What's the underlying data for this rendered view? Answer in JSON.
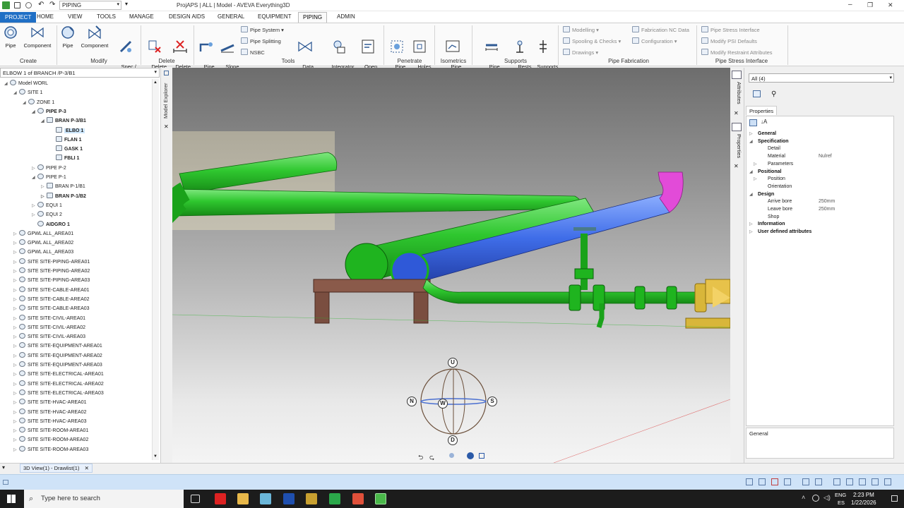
{
  "window": {
    "title": "ProjAPS | ALL | Model - AVEVA Everything3D",
    "quick_module": "PIPING",
    "controls": [
      "–",
      "❐",
      "✕"
    ]
  },
  "menu_tabs": [
    {
      "label": "PROJECT",
      "active": false,
      "project": true
    },
    {
      "label": "HOME"
    },
    {
      "label": "VIEW"
    },
    {
      "label": "TOOLS"
    },
    {
      "label": "MANAGE"
    },
    {
      "label": "DESIGN AIDS"
    },
    {
      "label": "GENERAL"
    },
    {
      "label": "EQUIPMENT"
    },
    {
      "label": "PIPING",
      "active": true
    },
    {
      "label": "ADMIN"
    }
  ],
  "ribbon": {
    "create": {
      "group": "Create",
      "buttons": [
        "Pipe",
        "Component"
      ]
    },
    "modify": {
      "group": "Modify",
      "buttons": [
        "Pipe",
        "Component",
        "Spec /\nBore ▾"
      ]
    },
    "delete": {
      "group": "Delete",
      "buttons": [
        "Delete\n▾",
        "Delete\nRange"
      ]
    },
    "tools": {
      "group": "Tools",
      "buttons": [
        "Pipe\nRouter",
        "Slope\nPipe",
        "Data\nConsistency",
        "Integrator\nMode",
        "Open\nDiagram"
      ],
      "small": [
        "Pipe System ▾",
        "Pipe Splitting",
        "NSBC"
      ]
    },
    "penetrate": {
      "group": "Penetrate",
      "buttons": [
        "Pipe\n▾",
        "Holes\n▾"
      ]
    },
    "isometrics": {
      "group": "Isometrics",
      "buttons": [
        "Pipe\n▾"
      ]
    },
    "supports": {
      "group": "Supports",
      "buttons": [
        "Pipe\nDimensions",
        "Rests",
        "Supports\nBrowser"
      ]
    },
    "fabrication": {
      "group": "Pipe Fabrication",
      "small": [
        "Modelling ▾",
        "Spooling & Checks ▾",
        "Drawings ▾",
        "Fabrication NC Data",
        "Configuration ▾"
      ]
    },
    "stress": {
      "group": "Pipe Stress Interface",
      "small": [
        "Pipe Stress Interface",
        "Modify PSI Defaults",
        "Modify Restraint Attributes"
      ]
    }
  },
  "explorer": {
    "current_element": "ELBOW 1 of BRANCH /P-3/B1",
    "vtab_label": "Model Explorer",
    "tree": [
      {
        "label": "Model WORL",
        "depth": 0,
        "exp": "◢",
        "bold": false
      },
      {
        "label": "SITE 1",
        "depth": 1,
        "exp": "◢"
      },
      {
        "label": "ZONE 1",
        "depth": 2,
        "exp": "◢"
      },
      {
        "label": "PIPE P-3",
        "depth": 3,
        "exp": "◢",
        "bold": true
      },
      {
        "label": "BRAN P-3/B1",
        "depth": 4,
        "exp": "◢",
        "bold": true
      },
      {
        "label": "ELBO 1",
        "depth": 5,
        "exp": "",
        "bold": true,
        "sel": true
      },
      {
        "label": "FLAN 1",
        "depth": 5,
        "exp": "",
        "bold": true
      },
      {
        "label": "GASK 1",
        "depth": 5,
        "exp": "",
        "bold": true
      },
      {
        "label": "FBLI 1",
        "depth": 5,
        "exp": "",
        "bold": true
      },
      {
        "label": "PIPE P-2",
        "depth": 3,
        "exp": "▷"
      },
      {
        "label": "PIPE P-1",
        "depth": 3,
        "exp": "◢"
      },
      {
        "label": "BRAN P-1/B1",
        "depth": 4,
        "exp": "▷"
      },
      {
        "label": "BRAN P-1/B2",
        "depth": 4,
        "exp": "▷",
        "bold": true
      },
      {
        "label": "EQUI 1",
        "depth": 3,
        "exp": "▷"
      },
      {
        "label": "EQUI 2",
        "depth": 3,
        "exp": "▷"
      },
      {
        "label": "AIDGRO 1",
        "depth": 3,
        "exp": "",
        "bold": true
      },
      {
        "label": "GPWL ALL_AREA01",
        "depth": 1,
        "exp": "▷"
      },
      {
        "label": "GPWL ALL_AREA02",
        "depth": 1,
        "exp": "▷"
      },
      {
        "label": "GPWL ALL_AREA03",
        "depth": 1,
        "exp": "▷"
      },
      {
        "label": "SITE SITE-PIPING-AREA01",
        "depth": 1,
        "exp": "▷"
      },
      {
        "label": "SITE SITE-PIPING-AREA02",
        "depth": 1,
        "exp": "▷"
      },
      {
        "label": "SITE SITE-PIPING-AREA03",
        "depth": 1,
        "exp": "▷"
      },
      {
        "label": "SITE SITE-CABLE-AREA01",
        "depth": 1,
        "exp": "▷"
      },
      {
        "label": "SITE SITE-CABLE-AREA02",
        "depth": 1,
        "exp": "▷"
      },
      {
        "label": "SITE SITE-CABLE-AREA03",
        "depth": 1,
        "exp": "▷"
      },
      {
        "label": "SITE SITE-CIVIL-AREA01",
        "depth": 1,
        "exp": "▷"
      },
      {
        "label": "SITE SITE-CIVIL-AREA02",
        "depth": 1,
        "exp": "▷"
      },
      {
        "label": "SITE SITE-CIVIL-AREA03",
        "depth": 1,
        "exp": "▷"
      },
      {
        "label": "SITE SITE-EQUIPMENT-AREA01",
        "depth": 1,
        "exp": "▷"
      },
      {
        "label": "SITE SITE-EQUIPMENT-AREA02",
        "depth": 1,
        "exp": "▷"
      },
      {
        "label": "SITE SITE-EQUIPMENT-AREA03",
        "depth": 1,
        "exp": "▷"
      },
      {
        "label": "SITE SITE-ELECTRICAL-AREA01",
        "depth": 1,
        "exp": "▷"
      },
      {
        "label": "SITE SITE-ELECTRICAL-AREA02",
        "depth": 1,
        "exp": "▷"
      },
      {
        "label": "SITE SITE-ELECTRICAL-AREA03",
        "depth": 1,
        "exp": "▷"
      },
      {
        "label": "SITE SITE-HVAC-AREA01",
        "depth": 1,
        "exp": "▷"
      },
      {
        "label": "SITE SITE-HVAC-AREA02",
        "depth": 1,
        "exp": "▷"
      },
      {
        "label": "SITE SITE-HVAC-AREA03",
        "depth": 1,
        "exp": "▷"
      },
      {
        "label": "SITE SITE-ROOM-AREA01",
        "depth": 1,
        "exp": "▷"
      },
      {
        "label": "SITE SITE-ROOM-AREA02",
        "depth": 1,
        "exp": "▷"
      },
      {
        "label": "SITE SITE-ROOM-AREA03",
        "depth": 1,
        "exp": "▷"
      }
    ]
  },
  "compass": {
    "up": "U",
    "down": "D",
    "north": "N",
    "south": "S",
    "west": "W"
  },
  "properties": {
    "vtabs": [
      "Attributes",
      "Properties"
    ],
    "filter": "All (4)",
    "tab": "Properties",
    "rows": [
      {
        "k": "General",
        "cat": true,
        "tg": "▷"
      },
      {
        "k": "Specification",
        "cat": true,
        "tg": "◢"
      },
      {
        "k": "Detail",
        "v": ""
      },
      {
        "k": "Material",
        "v": "Nulref"
      },
      {
        "k": "Parameters",
        "v": "",
        "tg": "▷"
      },
      {
        "k": "Positional",
        "cat": true,
        "tg": "◢"
      },
      {
        "k": "Position",
        "v": "",
        "tg": "▷"
      },
      {
        "k": "Orientation",
        "v": ""
      },
      {
        "k": "Design",
        "cat": true,
        "tg": "◢"
      },
      {
        "k": "Arrive bore",
        "v": "250mm"
      },
      {
        "k": "Leave bore",
        "v": "250mm"
      },
      {
        "k": "Shop",
        "v": ""
      },
      {
        "k": "Information",
        "cat": true,
        "tg": "▷"
      },
      {
        "k": "User defined attributes",
        "cat": true,
        "tg": "▷"
      }
    ],
    "desc_title": "General"
  },
  "doc_tab": {
    "label": "3D View(1) - Drawlist(1)",
    "close": "✕"
  },
  "taskbar": {
    "search_placeholder": "Type here to search",
    "lang_top": "ENG",
    "lang_bottom": "ES",
    "time": "2:23 PM",
    "date": "1/22/2026"
  },
  "colors": {
    "pipe_green": "#2fc72f",
    "pipe_blue": "#3f6de8",
    "elbow_magenta": "#e24bd8",
    "support_brown": "#8a5a4a",
    "equipment_yellow": "#d8b63a",
    "status_blue": "#cfe3f8"
  }
}
